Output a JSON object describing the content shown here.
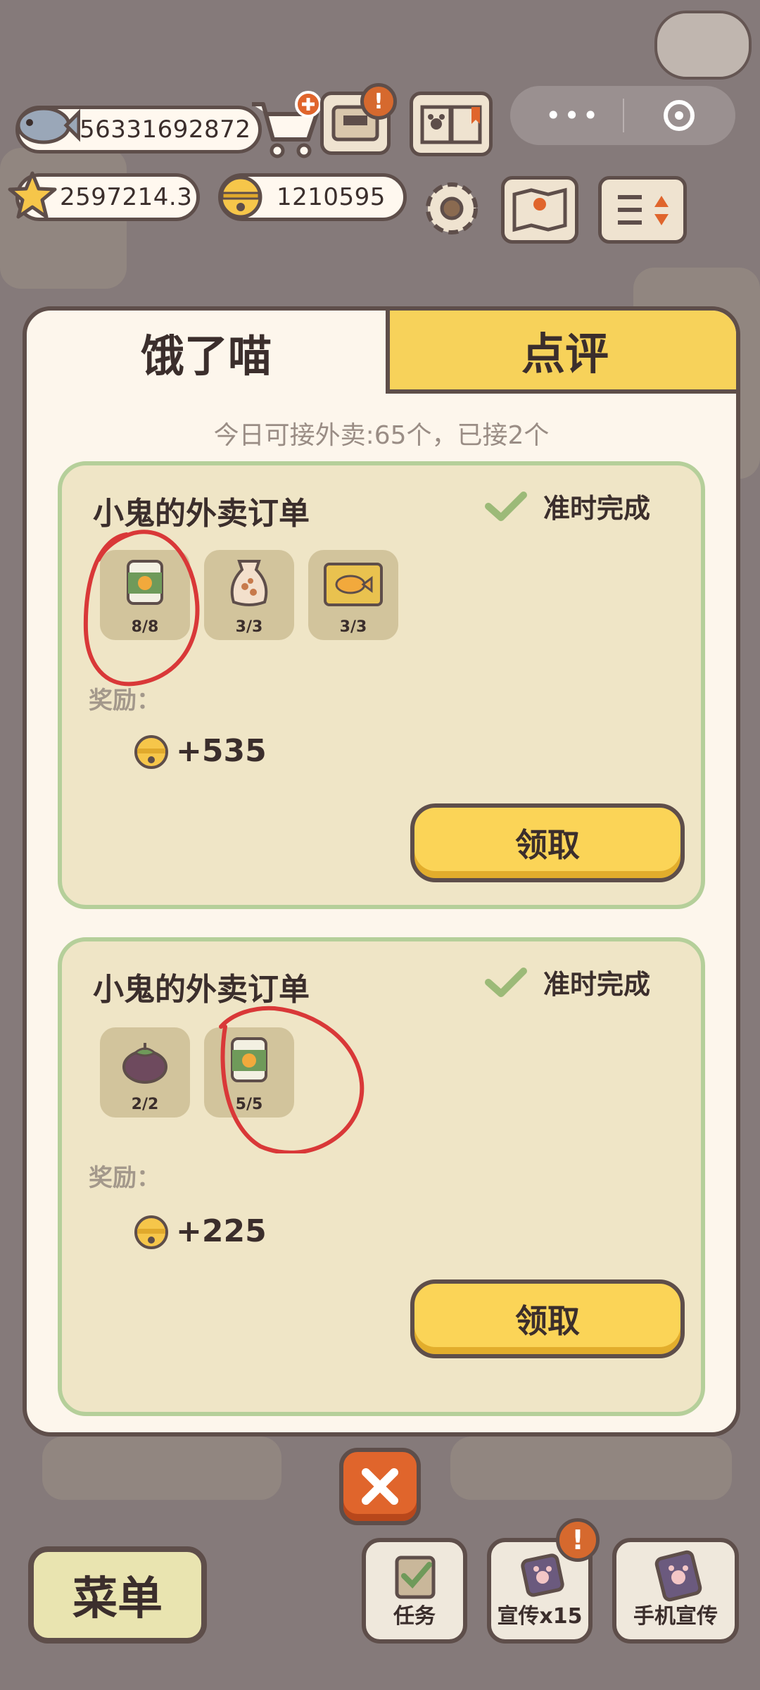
{
  "resources": {
    "fish": "56331692872",
    "stars": "2597214.3",
    "bells": "1210595"
  },
  "panel": {
    "tab_active": "饿了喵",
    "tab_inactive": "点评",
    "quota_text": "今日可接外卖:65个，已接2个"
  },
  "orders": [
    {
      "title": "小鬼的外卖订单",
      "status": "准时完成",
      "items": [
        {
          "icon": "cat-can-icon",
          "count": "8/8"
        },
        {
          "icon": "treat-bag-icon",
          "count": "3/3"
        },
        {
          "icon": "fish-cracker-icon",
          "count": "3/3"
        }
      ],
      "reward_label": "奖励：",
      "reward_value": "+535",
      "claim_label": "领取"
    },
    {
      "title": "小鬼的外卖订单",
      "status": "准时完成",
      "items": [
        {
          "icon": "mangosteen-icon",
          "count": "2/2"
        },
        {
          "icon": "cat-can-icon",
          "count": "5/5"
        }
      ],
      "reward_label": "奖励：",
      "reward_value": "+225",
      "claim_label": "领取"
    }
  ],
  "bottom": {
    "menu_label": "菜单",
    "tasks_label": "任务",
    "promo_label": "宣传x15",
    "phone_promo_label": "手机宣传"
  },
  "colors": {
    "accent_yellow": "#fbd457",
    "border_brown": "#5e4e4a",
    "order_bg": "#efe5c6",
    "check_green": "#9cba78",
    "close_orange": "#e0652c",
    "annotation_red": "#d93838"
  }
}
